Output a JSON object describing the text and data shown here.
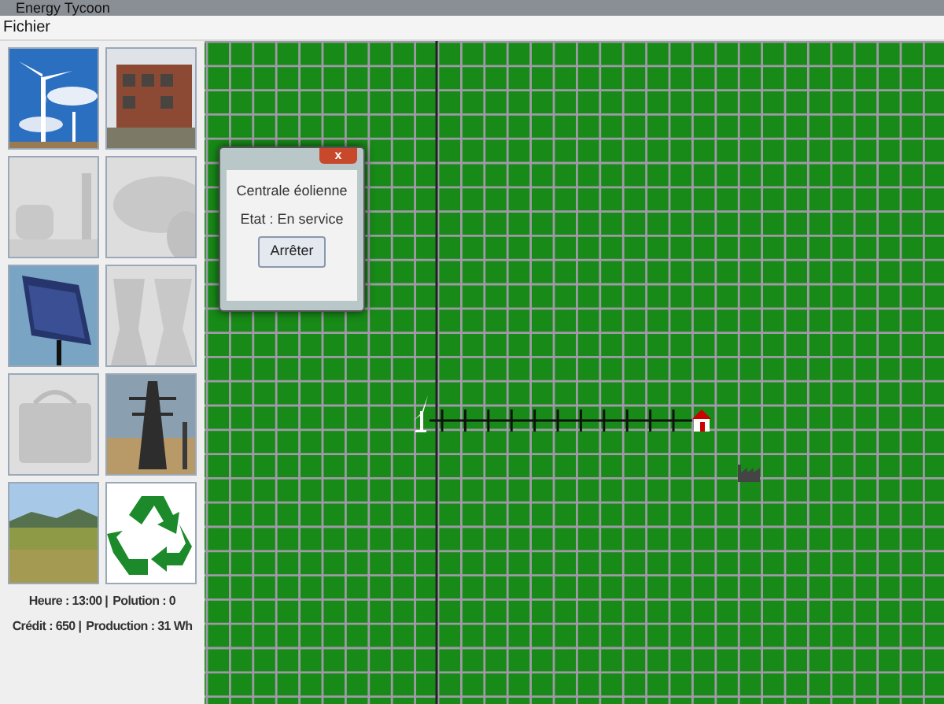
{
  "window": {
    "title": "Energy Tycoon"
  },
  "menu": [
    "Fichier"
  ],
  "palette": [
    {
      "kind": "wind",
      "disabled": false
    },
    {
      "kind": "building",
      "disabled": false
    },
    {
      "kind": "nuclear",
      "disabled": true
    },
    {
      "kind": "coal",
      "disabled": true
    },
    {
      "kind": "solar",
      "disabled": false
    },
    {
      "kind": "cooling",
      "disabled": true
    },
    {
      "kind": "battery",
      "disabled": true
    },
    {
      "kind": "pylon",
      "disabled": false
    },
    {
      "kind": "field",
      "disabled": false
    },
    {
      "kind": "recycle",
      "disabled": false
    }
  ],
  "status": [
    [
      "Heure : 13:00 |",
      "Polution : 0"
    ],
    [
      "Crédit : 650 |",
      "Production : 31 Wh"
    ]
  ],
  "map": {
    "items": [
      {
        "kind": "wind-turbine"
      },
      {
        "kind": "power-line"
      },
      {
        "kind": "house"
      },
      {
        "kind": "factory"
      }
    ]
  },
  "dialog": {
    "close": "x",
    "title": "Centrale éolienne",
    "state": "Etat : En service",
    "button": "Arrêter"
  }
}
